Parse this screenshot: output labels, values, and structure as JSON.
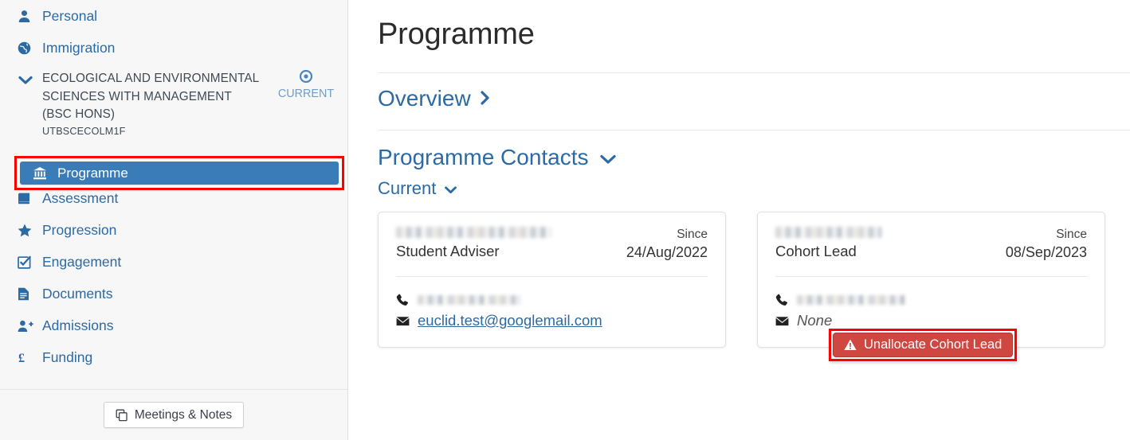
{
  "sidebar": {
    "items_top": [
      {
        "label": "Personal",
        "icon": "user-icon"
      },
      {
        "label": "Immigration",
        "icon": "globe-icon"
      }
    ],
    "programme_group": {
      "title": "ECOLOGICAL AND ENVIRONMENTAL SCIENCES WITH MANAGEMENT (BSC HONS)",
      "code": "UTBSCECOLM1F",
      "chevron": "chevron-down-icon",
      "badge_label": "CURRENT",
      "badge_icon": "target-icon"
    },
    "active_item": {
      "label": "Programme",
      "icon": "bank-icon"
    },
    "items_bottom": [
      {
        "label": "Assessment",
        "icon": "book-icon"
      },
      {
        "label": "Progression",
        "icon": "star-icon"
      },
      {
        "label": "Engagement",
        "icon": "check-square-icon"
      },
      {
        "label": "Documents",
        "icon": "file-text-icon"
      },
      {
        "label": "Admissions",
        "icon": "user-plus-icon"
      },
      {
        "label": "Funding",
        "icon": "pound-icon"
      }
    ],
    "footer_button": {
      "label": "Meetings & Notes",
      "icon": "copy-icon"
    }
  },
  "main": {
    "page_title": "Programme",
    "overview": {
      "label": "Overview",
      "icon": "chevron-right-icon"
    },
    "contacts_section": {
      "label": "Programme Contacts",
      "icon": "chevron-down-icon"
    },
    "current_filter": {
      "label": "Current",
      "icon": "chevron-down-icon"
    },
    "cards": [
      {
        "name_redacted": true,
        "role": "Student Adviser",
        "since_label": "Since",
        "since_date": "24/Aug/2022",
        "phone_redacted": true,
        "email": "euclid.test@googlemail.com",
        "email_is_link": true
      },
      {
        "name_redacted": true,
        "role": "Cohort Lead",
        "since_label": "Since",
        "since_date": "08/Sep/2023",
        "phone_redacted": true,
        "email": "None",
        "email_is_link": false,
        "action_button": {
          "label": "Unallocate Cohort Lead",
          "icon": "warning-triangle-icon"
        }
      }
    ]
  },
  "colors": {
    "link_blue": "#2b6aa5",
    "active_nav_blue": "#3a7cb8",
    "danger_red": "#cf4741",
    "highlight_red": "#fd0000",
    "sidebar_bg": "#f7f7f7",
    "badge_blue": "#6f9ec9"
  }
}
